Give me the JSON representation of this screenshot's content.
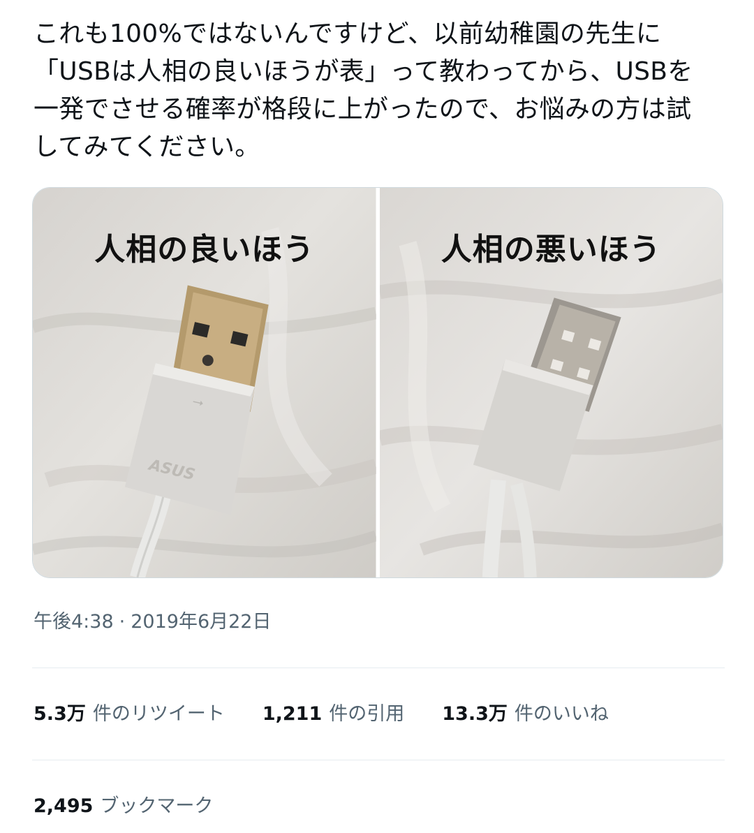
{
  "tweet": {
    "text_lines": [
      "これも100%ではないんですけど、以前幼稚園の先生に",
      "「USBは人相の良いほうが表」って教わってから、USBを",
      "一発でさせる確率が格段に上がったので、お悩みの方は試",
      "してみてください。"
    ]
  },
  "media": {
    "photos": [
      {
        "caption": "人相の良いほう",
        "brand_text": "ASUS"
      },
      {
        "caption": "人相の悪いほう"
      }
    ]
  },
  "timestamp": {
    "time": "午後4:38",
    "separator": "·",
    "date": "2019年6月22日"
  },
  "stats": {
    "retweets": {
      "count": "5.3万",
      "label": "件のリツイート"
    },
    "quotes": {
      "count": "1,211",
      "label": "件の引用"
    },
    "likes": {
      "count": "13.3万",
      "label": "件のいいね"
    }
  },
  "bookmarks": {
    "count": "2,495",
    "label": "ブックマーク"
  }
}
